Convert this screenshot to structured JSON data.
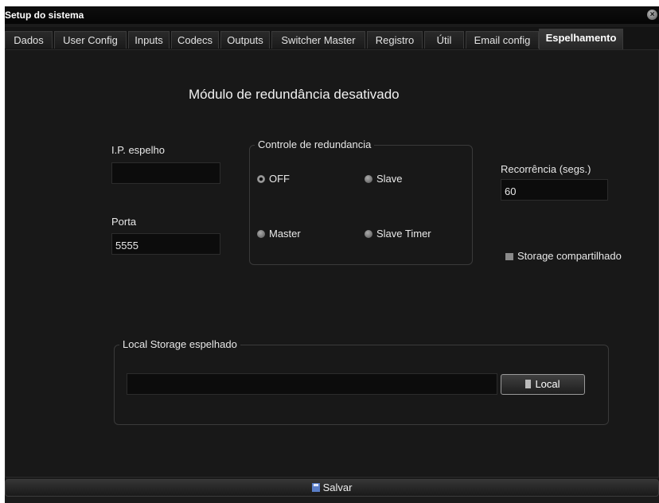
{
  "window": {
    "title": "Setup do sistema"
  },
  "tabs": [
    {
      "label": "Dados"
    },
    {
      "label": "User Config"
    },
    {
      "label": "Inputs"
    },
    {
      "label": "Codecs"
    },
    {
      "label": "Outputs"
    },
    {
      "label": "Switcher Master"
    },
    {
      "label": "Registro"
    },
    {
      "label": "Útil"
    },
    {
      "label": "Email config"
    },
    {
      "label": "Espelhamento",
      "active": true
    }
  ],
  "status_message": "Módulo de redundância desativado",
  "mirror_ip": {
    "label": "I.P. espelho",
    "value": ""
  },
  "port": {
    "label": "Porta",
    "value": "5555"
  },
  "redundancy": {
    "legend": "Controle de redundancia",
    "options": [
      {
        "label": "OFF",
        "selected": true
      },
      {
        "label": "Slave",
        "selected": false
      },
      {
        "label": "Master",
        "selected": false
      },
      {
        "label": "Slave Timer",
        "selected": false
      }
    ]
  },
  "recurrence": {
    "label": "Recorrência (segs.)",
    "value": "60"
  },
  "shared_storage": {
    "label": "Storage compartilhado",
    "checked": false
  },
  "local_storage": {
    "legend": "Local Storage espelhado",
    "value": "",
    "button_label": "Local"
  },
  "footer": {
    "save_label": "Salvar"
  },
  "colors": {
    "background": "#181818",
    "field": "#0c0c0c",
    "accent": "#5a7ec8"
  }
}
